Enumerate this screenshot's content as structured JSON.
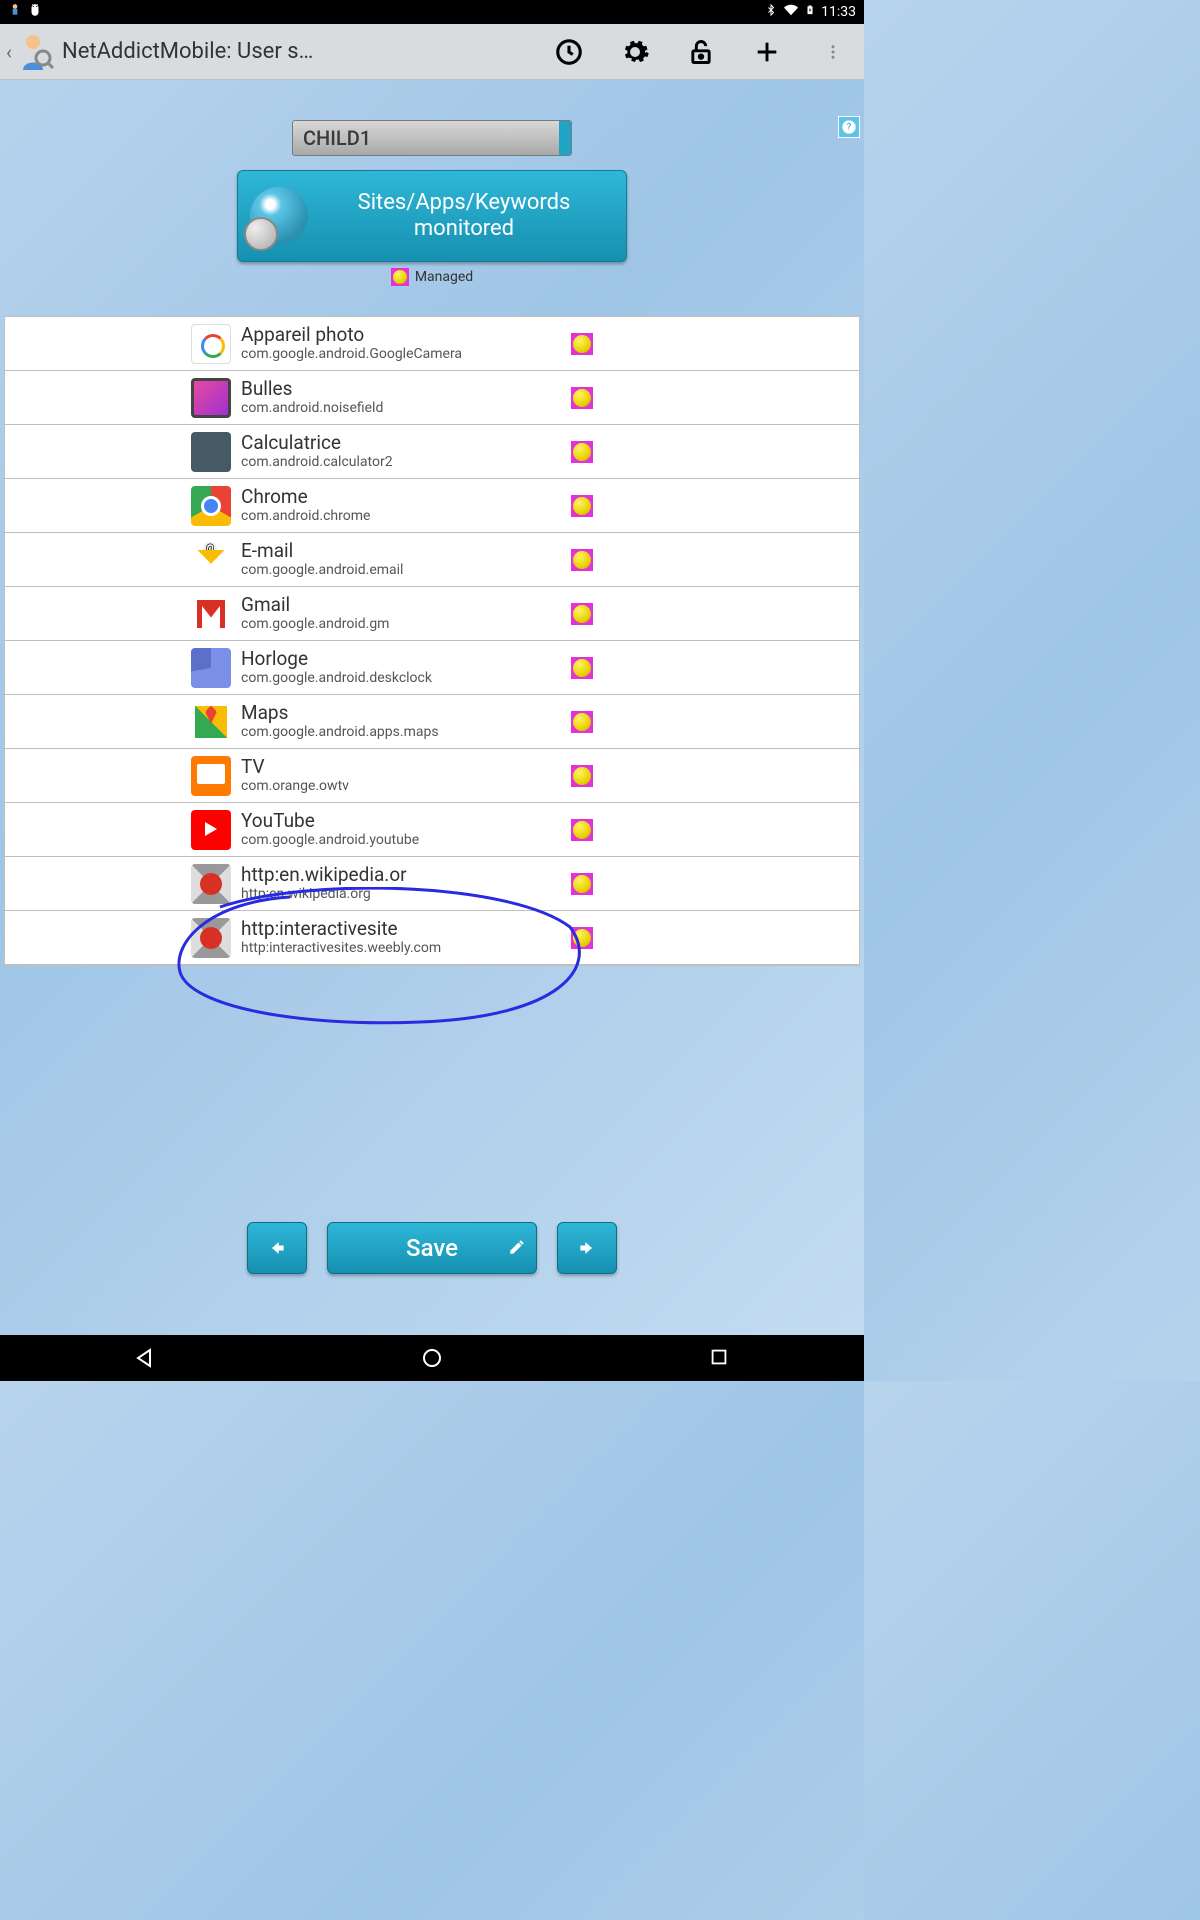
{
  "status": {
    "time": "11:33"
  },
  "header": {
    "title": "NetAddictMobile: User s…"
  },
  "user_selector": {
    "value": "CHILD1"
  },
  "monitor_button": {
    "line1": "Sites/Apps/Keywords",
    "line2": "monitored"
  },
  "legend": {
    "managed": "Managed"
  },
  "apps": [
    {
      "name": "Appareil photo",
      "pkg": "com.google.android.GoogleCamera",
      "icon": "camera",
      "managed": true
    },
    {
      "name": "Bulles",
      "pkg": "com.android.noisefield",
      "icon": "bulles",
      "managed": true
    },
    {
      "name": "Calculatrice",
      "pkg": "com.android.calculator2",
      "icon": "calc",
      "managed": true
    },
    {
      "name": "Chrome",
      "pkg": "com.android.chrome",
      "icon": "chrome",
      "managed": true
    },
    {
      "name": "E-mail",
      "pkg": "com.google.android.email",
      "icon": "email",
      "managed": true
    },
    {
      "name": "Gmail",
      "pkg": "com.google.android.gm",
      "icon": "gmail",
      "managed": true
    },
    {
      "name": "Horloge",
      "pkg": "com.google.android.deskclock",
      "icon": "clock",
      "managed": true
    },
    {
      "name": "Maps",
      "pkg": "com.google.android.apps.maps",
      "icon": "maps",
      "managed": true
    },
    {
      "name": "TV",
      "pkg": "com.orange.owtv",
      "icon": "tv",
      "managed": true
    },
    {
      "name": "YouTube",
      "pkg": "com.google.android.youtube",
      "icon": "yt",
      "managed": true
    },
    {
      "name": "http:en.wikipedia.or",
      "pkg": "http:en.wikipedia.org",
      "icon": "na",
      "managed": true
    },
    {
      "name": "http:interactivesite",
      "pkg": "http:interactivesites.weebly.com",
      "icon": "na",
      "managed": true
    }
  ],
  "buttons": {
    "save": "Save"
  }
}
